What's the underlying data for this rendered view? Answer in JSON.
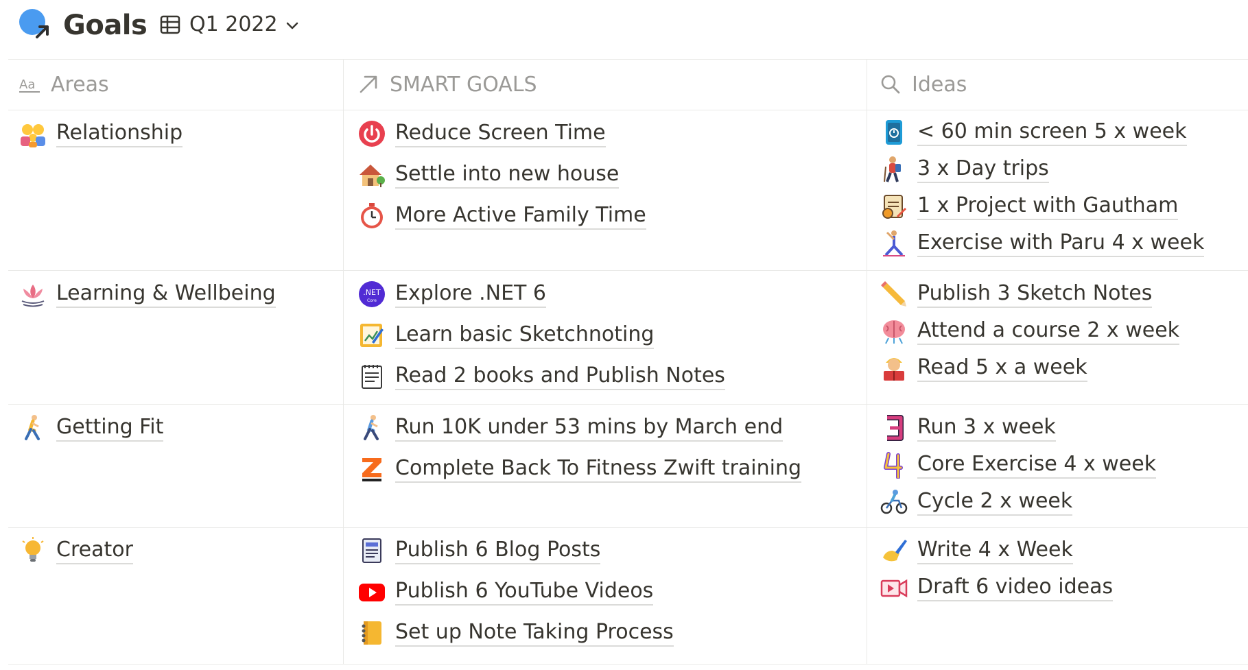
{
  "page": {
    "title": "Goals",
    "view_name": "Q1 2022"
  },
  "columns": {
    "areas": "Areas",
    "goals": "SMART GOALS",
    "ideas": "Ideas"
  },
  "rows": [
    {
      "area": {
        "label": "Relationship",
        "icon": "family-icon"
      },
      "goals": [
        {
          "label": "Reduce Screen Time",
          "icon": "power-icon"
        },
        {
          "label": "Settle into new house",
          "icon": "house-icon"
        },
        {
          "label": "More Active Family Time",
          "icon": "stopwatch-icon"
        }
      ],
      "ideas": [
        {
          "label": "< 60 min screen 5 x week",
          "icon": "phone-timer-icon"
        },
        {
          "label": "3 x Day trips",
          "icon": "hiker-icon"
        },
        {
          "label": "1 x Project with Gautham",
          "icon": "project-icon"
        },
        {
          "label": "Exercise with Paru 4 x week",
          "icon": "yoga-icon"
        }
      ]
    },
    {
      "area": {
        "label": "Learning & Wellbeing",
        "icon": "lotus-icon"
      },
      "goals": [
        {
          "label": "Explore .NET 6",
          "icon": "dotnet-icon"
        },
        {
          "label": "Learn basic Sketchnoting",
          "icon": "sketch-icon"
        },
        {
          "label": "Read 2 books and Publish Notes",
          "icon": "notepad-icon"
        }
      ],
      "ideas": [
        {
          "label": "Publish 3 Sketch Notes",
          "icon": "pencil-icon"
        },
        {
          "label": "Attend a course 2 x week",
          "icon": "brain-icon"
        },
        {
          "label": "Read 5 x a week",
          "icon": "reader-icon"
        }
      ]
    },
    {
      "area": {
        "label": "Getting Fit",
        "icon": "runner-icon"
      },
      "goals": [
        {
          "label": "Run 10K under 53 mins by March end",
          "icon": "runner-icon"
        },
        {
          "label": "Complete Back To Fitness Zwift training",
          "icon": "zwift-icon"
        }
      ],
      "ideas": [
        {
          "label": "Run 3 x week",
          "icon": "number-3-icon"
        },
        {
          "label": "Core Exercise 4 x week",
          "icon": "number-4-icon"
        },
        {
          "label": "Cycle 2 x week",
          "icon": "cyclist-icon"
        }
      ]
    },
    {
      "area": {
        "label": "Creator",
        "icon": "lightbulb-icon"
      },
      "goals": [
        {
          "label": "Publish 6 Blog Posts",
          "icon": "blog-icon"
        },
        {
          "label": "Publish 6 YouTube Videos",
          "icon": "youtube-icon"
        },
        {
          "label": "Set up Note Taking Process",
          "icon": "notebook-icon"
        }
      ],
      "ideas": [
        {
          "label": "Write 4 x Week",
          "icon": "writing-hand-icon"
        },
        {
          "label": "Draft 6 video ideas",
          "icon": "video-camera-icon"
        }
      ]
    }
  ]
}
